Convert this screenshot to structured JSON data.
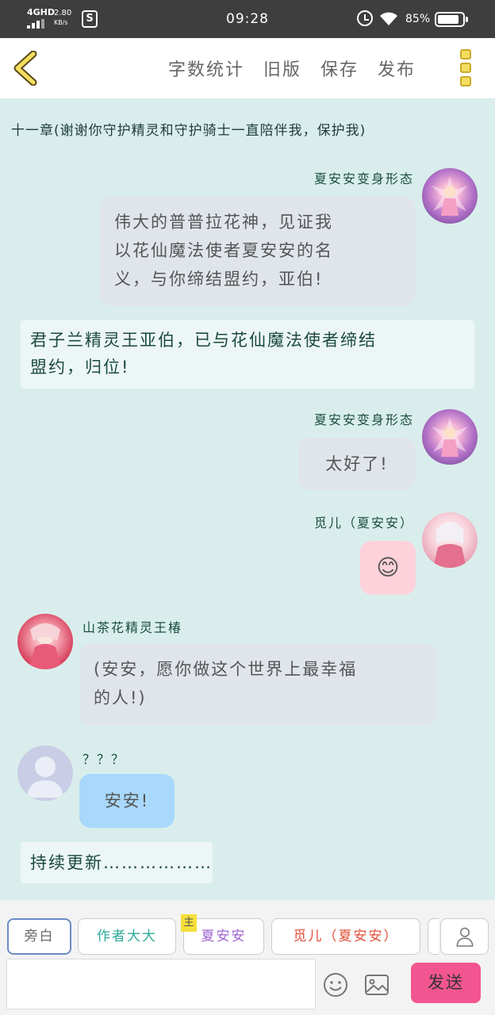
{
  "status_bar": {
    "network": "4GHD",
    "speed_value": "2.80",
    "speed_unit": "KB/s",
    "time": "09:28",
    "battery_percent": "85%",
    "battery_level": 0.85
  },
  "header": {
    "actions": [
      "字数统计",
      "旧版",
      "保存",
      "发布"
    ]
  },
  "chat": {
    "chapter_title": "十一章(谢谢你守护精灵和守护骑士一直陪伴我，保护我)",
    "messages": [
      {
        "speaker": "夏安安变身形态",
        "lines": [
          "伟大的普普拉花神，见证我",
          "以花仙魔法使者夏安安的名",
          "义，与你缔结盟约，亚伯!"
        ]
      },
      {
        "narration_lines": [
          "君子兰精灵王亚伯，已与花仙魔法使者缔结",
          "盟约，归位!"
        ]
      },
      {
        "speaker": "夏安安变身形态",
        "text": "太好了!"
      },
      {
        "speaker": "觅儿（夏安安）",
        "emoji": "😊"
      },
      {
        "speaker": "山茶花精灵王椿",
        "lines": [
          "(安安，愿你做这个世界上最幸福",
          "的人!)"
        ]
      },
      {
        "speaker": "？？？",
        "text": "安安!"
      },
      {
        "narration": "持续更新………………"
      }
    ]
  },
  "bottom": {
    "chips": [
      "旁白",
      "作者大大",
      "夏安安",
      "觅儿（夏安安）"
    ],
    "main_badge": "主",
    "send_label": "发送"
  },
  "colors": {
    "background": "#d9eeec",
    "send_button": "#f2558f",
    "blue_bubble": "#a8d8fb",
    "pink_bubble": "#fdd2da",
    "chip_author": "#2ea99a",
    "chip_xiaanan": "#a065d0",
    "chip_mier": "#e0503a"
  }
}
